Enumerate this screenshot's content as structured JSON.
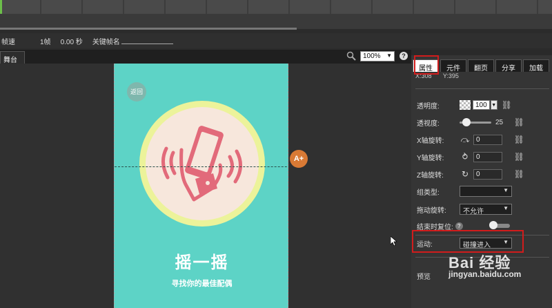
{
  "info_bar": {
    "speed_label": "帧速",
    "frame_value": "1帧",
    "seconds_value": "0.00 秒",
    "keyframe_name_label": "关键帧名"
  },
  "stage": {
    "tab_label": "舞台",
    "zoom_value": "100%",
    "help_glyph": "?"
  },
  "canvas": {
    "back_label": "返回",
    "title": "摇一摇",
    "subtitle": "寻找你的最佳配偶",
    "add_animation_label": "A+"
  },
  "panel": {
    "tabs": [
      {
        "label": "属性",
        "active": true
      },
      {
        "label": "元件",
        "active": false
      },
      {
        "label": "翻页",
        "active": false
      },
      {
        "label": "分享",
        "active": false
      },
      {
        "label": "加载",
        "active": false
      }
    ],
    "coords": {
      "x": "X:308",
      "y": "Y:395"
    },
    "opacity": {
      "label": "透明度:",
      "value": "100"
    },
    "perspective": {
      "label": "透视度:",
      "value": "25"
    },
    "x_rotation": {
      "label": "X轴旋转:",
      "value": "0"
    },
    "y_rotation": {
      "label": "Y轴旋转:",
      "value": "0"
    },
    "z_rotation": {
      "label": "Z轴旋转:",
      "value": "0"
    },
    "group_type": {
      "label": "组类型:",
      "value": ""
    },
    "drag_rotate": {
      "label": "拖动旋转:",
      "value": "不允许"
    },
    "reset_on_end": {
      "label": "结束时复位:",
      "help_glyph": "?"
    },
    "motion": {
      "label": "运动:",
      "value": "碰撞进入"
    },
    "preview_label": "预览"
  },
  "watermark": {
    "logo_text": "Bai 经验",
    "url_text": "jingyan.baidu.com"
  },
  "colors": {
    "canvas_bg": "#5dd3c6",
    "highlight_red": "#d21c1c",
    "circle_yellow": "#ecf39a",
    "phone_pink": "#e26a7a",
    "add_button_orange": "#d97a35"
  }
}
